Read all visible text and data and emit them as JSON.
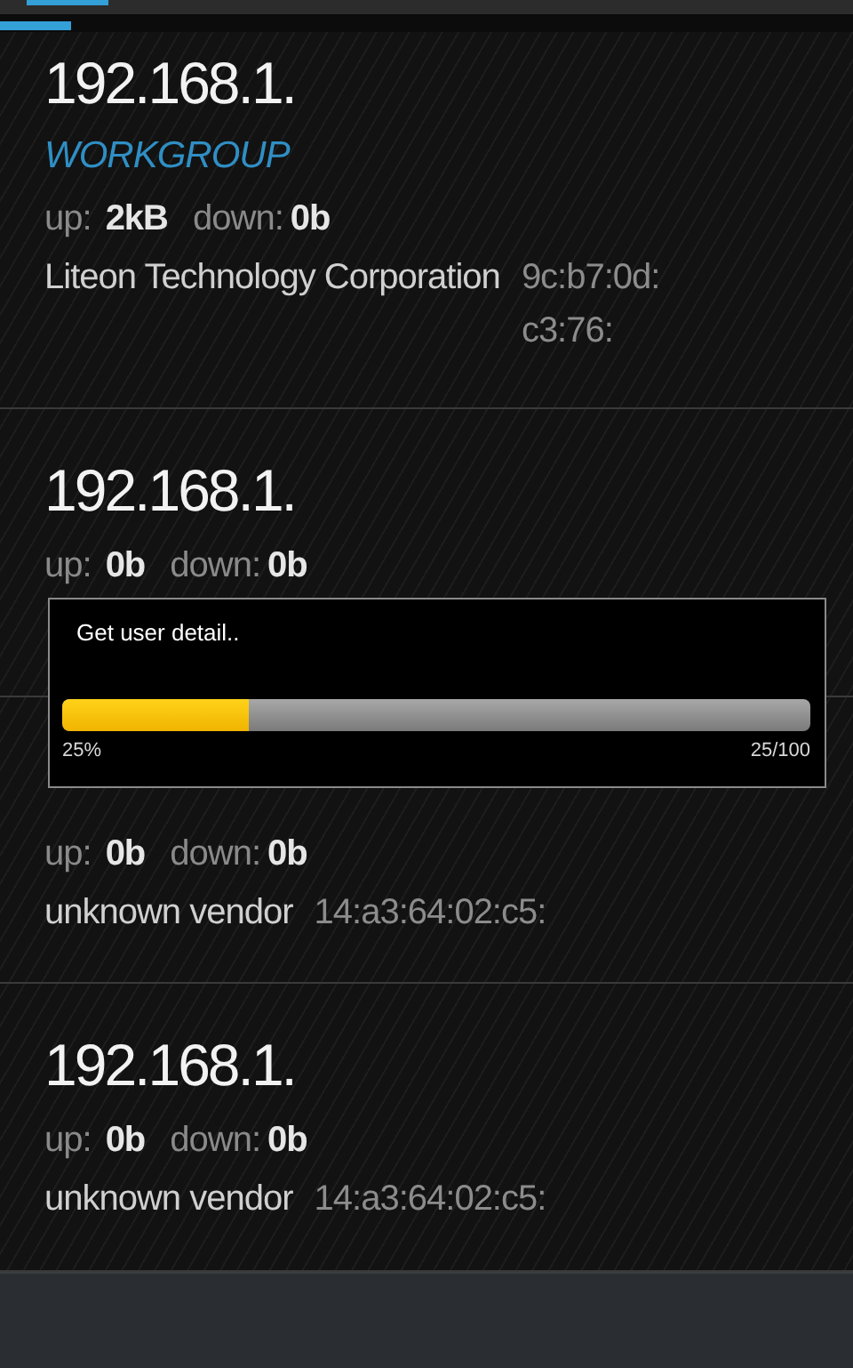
{
  "devices": [
    {
      "ip": "192.168.1.",
      "workgroup": "WORKGROUP",
      "up_label": "up:",
      "up": "2kB",
      "down_label": "down:",
      "down": "0b",
      "vendor": "Liteon Technology Corporation",
      "mac": [
        "9c:b7:0d:",
        "c3:76:"
      ]
    },
    {
      "ip": "192.168.1.",
      "up_label": "up:",
      "up": "0b",
      "down_label": "down:",
      "down": "0b"
    },
    {
      "up_label": "up:",
      "up": "0b",
      "down_label": "down:",
      "down": "0b",
      "vendor": "unknown vendor",
      "mac": [
        "14:a3:64:02:c5:"
      ]
    },
    {
      "ip": "192.168.1.",
      "up_label": "up:",
      "up": "0b",
      "down_label": "down:",
      "down": "0b",
      "vendor": "unknown vendor",
      "mac": [
        "14:a3:64:02:c5:"
      ]
    }
  ],
  "dialog": {
    "message": "Get user detail..",
    "level": 0.25,
    "percent": "25%",
    "count": "25/100"
  }
}
